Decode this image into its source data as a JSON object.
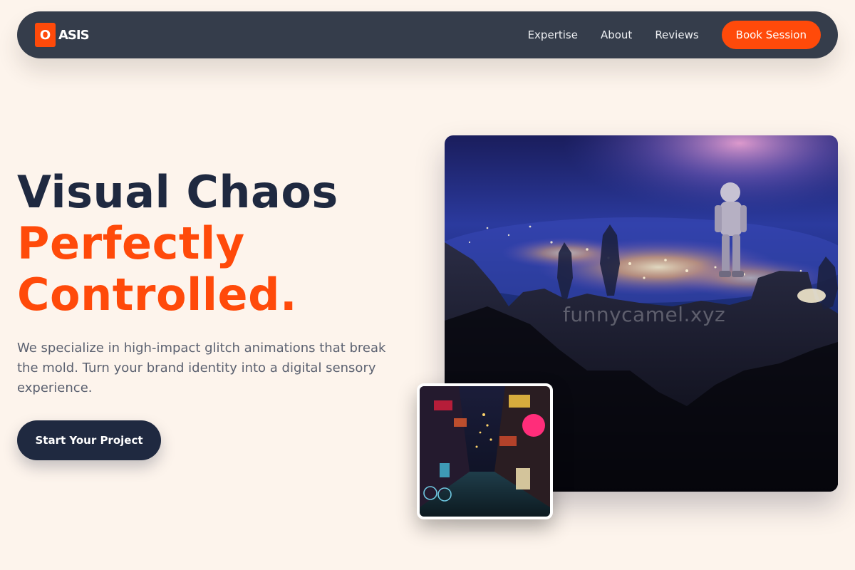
{
  "nav": {
    "logo_mark": "O",
    "logo_text": "ASIS",
    "links": [
      "Expertise",
      "About",
      "Reviews"
    ],
    "cta": "Book Session"
  },
  "hero": {
    "title_line1": "Visual Chaos",
    "title_line2": "Perfectly",
    "title_line3": "Controlled.",
    "description": "We specialize in high-impact glitch animations that break the mold. Turn your brand identity into a digital sensory experience.",
    "cta": "Start Your Project"
  },
  "images": {
    "main_watermark": "funnycamel.xyz",
    "main_icon": "astronaut-night-city-image",
    "secondary_icon": "neon-alley-image"
  },
  "colors": {
    "accent": "#ff4a0a",
    "nav_bg": "#353d4b",
    "dark": "#1f2940",
    "page_bg": "#fdf4ec"
  }
}
